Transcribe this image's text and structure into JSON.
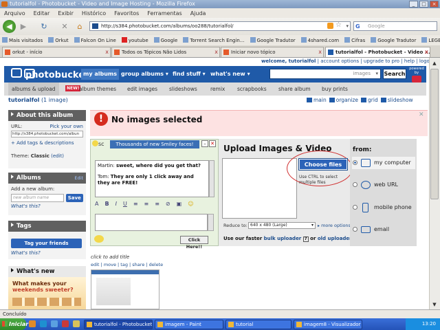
{
  "window": {
    "title": "tutorialfol - Photobucket - Video and Image Hosting - Mozilla Firefox"
  },
  "menu": [
    "Arquivo",
    "Editar",
    "Exibir",
    "Histórico",
    "Favoritos",
    "Ferramentas",
    "Ajuda"
  ],
  "url": "http://s384.photobucket.com/albums/oo288/tutorialfol/",
  "search_placeholder": "Google",
  "bookmarks": [
    "Mais visitados",
    "Orkut",
    "Falcon On Line",
    "youtube",
    "Google",
    "Torrent Search Engin...",
    "Google Tradutor",
    "4shared.com",
    "Cifras",
    "Google Tradutor",
    "LEGENDAS.TV -"
  ],
  "tabs": [
    "orkut - início",
    "Todos os Tópicos Não Lidos",
    "Iniciar novo tópico",
    "tutorialfol - Photobucket - Video ..."
  ],
  "toplinks": {
    "welcome": "welcome, tutorialfol",
    "links": [
      "account options",
      "upgrade to pro",
      "help",
      "logout"
    ]
  },
  "brand": {
    "logo": "photobucket",
    "powered_by": "powered by"
  },
  "mainnav": [
    "my albums",
    "group albums ▾",
    "find stuff ▾",
    "what's new ▾"
  ],
  "pbsearch": {
    "placeholder": "images",
    "button": "Search"
  },
  "subnav": [
    "albums & upload",
    "album themes",
    "edit images",
    "slideshows",
    "remix",
    "scrapbooks",
    "share album",
    "buy prints"
  ],
  "subnav_badge": "NEW!",
  "breadcrumb": {
    "album": "tutorialfol",
    "count": "(1 image)"
  },
  "views": [
    "main",
    "organize",
    "grid",
    "slideshow"
  ],
  "about": {
    "title": "About this album",
    "url_label": "URL:",
    "pick_own": "Pick your own",
    "url_value": "http://s384.photobucket.com/albun",
    "tags_link": "+ Add tags & descriptions",
    "theme_label": "Theme:",
    "theme_value": "Classic",
    "theme_edit": "(edit)"
  },
  "albums": {
    "title": "Albums",
    "edit": "Edit",
    "add_label": "Add a new album:",
    "placeholder": "new album name",
    "save": "Save",
    "whats_this": "What's this?"
  },
  "tags": {
    "title": "Tags",
    "button": "Tag your friends",
    "whats_this": "What's this?"
  },
  "whatsnew": {
    "title": "What's new",
    "promo_line1": "What makes your",
    "promo_line2": "weekends sweeter?"
  },
  "error": {
    "message": "No images selected"
  },
  "chat": {
    "title": "Thousands of new Smiley faces!",
    "sm": "sc",
    "line1_name": "Martin:",
    "line1_text": "sweet, where did you get that?",
    "line2_name": "Tom:",
    "line2_text": "They are only 1 click away and they are FREE!",
    "click_here": "Click Here!!"
  },
  "upload": {
    "title": "Upload Images & Video",
    "choose": "Choose files",
    "hint": "Use CTRL to select multiple files",
    "reduce_label": "Reduce to:",
    "reduce_value": "640 x 480 (Large)",
    "more_options": "more options",
    "bulk_prefix": "Use our faster",
    "bulk_link": "bulk uploader",
    "bulk_q": "?",
    "bulk_or": "or",
    "old_link": "old uploader"
  },
  "from": {
    "label": "from:",
    "options": [
      "my computer",
      "web URL",
      "mobile phone",
      "email"
    ],
    "selected": 0
  },
  "image": {
    "title_prompt": "click to add title",
    "actions": [
      "edit",
      "move",
      "tag",
      "share",
      "delete"
    ]
  },
  "status": "Concluído",
  "taskbar": {
    "start": "Iniciar",
    "items": [
      "tutorialfol - Photobucket ...",
      "imagem - Paint",
      "tutorial",
      "imagem8 - Visualizador d..."
    ],
    "clock": "13:20"
  }
}
